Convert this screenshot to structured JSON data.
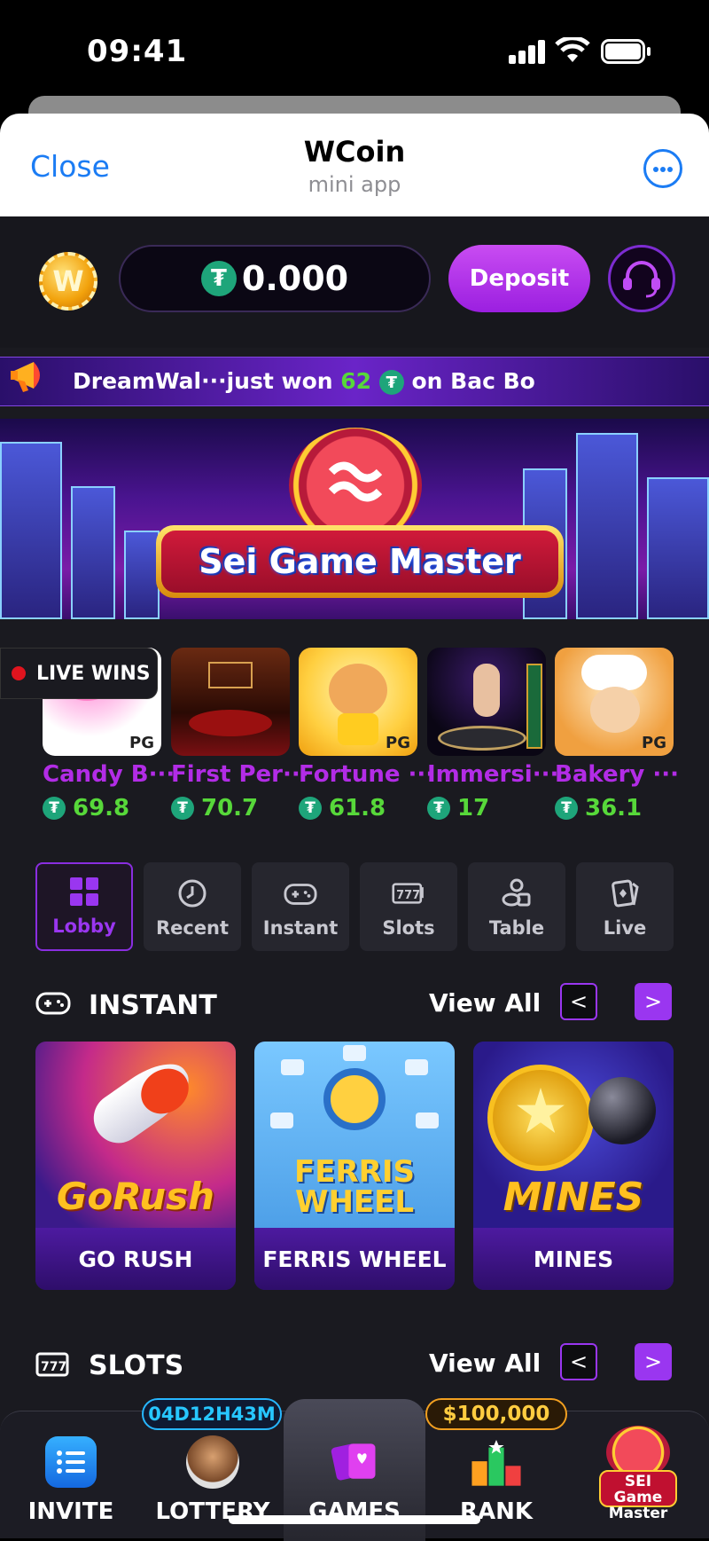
{
  "status_bar": {
    "time": "09:41"
  },
  "header": {
    "close_label": "Close",
    "title": "WCoin",
    "subtitle": "mini app"
  },
  "wallet": {
    "coin_letter": "W",
    "balance": "0.000",
    "currency_icon": "tether-icon",
    "deposit_label": "Deposit",
    "support_icon": "headset-icon"
  },
  "ticker": {
    "user": "DreamWal···just won",
    "amount": "62",
    "game": "on Bac Bo"
  },
  "banner": {
    "title": "Sei Game Master"
  },
  "live_wins": {
    "label": "LIVE WINS",
    "items": [
      {
        "name": "Candy B···",
        "amount": "69.8",
        "badge": "PG"
      },
      {
        "name": "First Per···",
        "amount": "70.7",
        "badge": ""
      },
      {
        "name": "Fortune ···",
        "amount": "61.8",
        "badge": "PG"
      },
      {
        "name": "Immersi···",
        "amount": "17",
        "badge": ""
      },
      {
        "name": "Bakery ···",
        "amount": "36.1",
        "badge": "PG"
      }
    ]
  },
  "categories": [
    {
      "label": "Lobby",
      "icon": "grid-icon"
    },
    {
      "label": "Recent",
      "icon": "clock-icon"
    },
    {
      "label": "Instant",
      "icon": "gamepad-icon"
    },
    {
      "label": "Slots",
      "icon": "slot-machine-icon"
    },
    {
      "label": "Table",
      "icon": "chips-icon"
    },
    {
      "label": "Live",
      "icon": "cards-icon"
    }
  ],
  "instant_section": {
    "title": "INSTANT",
    "view_all": "View All",
    "prev": "<",
    "next": ">",
    "games": [
      {
        "label": "GO RUSH",
        "art_text": "GoRush"
      },
      {
        "label": "FERRIS WHEEL",
        "art_text": "FERRIS WHEEL"
      },
      {
        "label": "MINES",
        "art_text": "MINES"
      }
    ]
  },
  "slots_section": {
    "title": "SLOTS",
    "view_all": "View All",
    "prev": "<",
    "next": ">"
  },
  "tabbar": {
    "countdown": "04D12H43M",
    "prize": "$100,000",
    "tabs": [
      {
        "label": "INVITE"
      },
      {
        "label": "LOTTERY"
      },
      {
        "label": "GAMES"
      },
      {
        "label": "RANK"
      },
      {
        "label": "SEI Game Master"
      }
    ]
  },
  "colors": {
    "accent": "#9a36f0",
    "win_green": "#57d83a",
    "link_blue": "#1b7cf4",
    "tether": "#1ea57a"
  }
}
